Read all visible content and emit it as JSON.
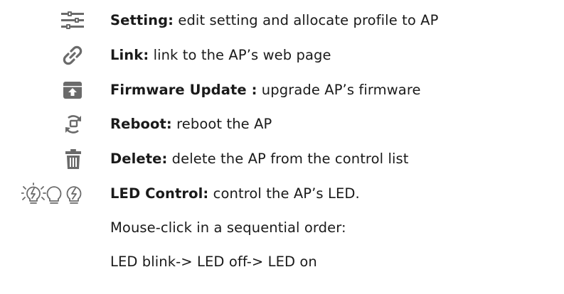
{
  "items": [
    {
      "icon": "settings-sliders-icon",
      "label": "Setting:",
      "desc": " edit setting and allocate profile to AP"
    },
    {
      "icon": "link-icon",
      "label": "Link:",
      "desc": " link to the AP’s web page"
    },
    {
      "icon": "firmware-update-icon",
      "label": "Firmware Update :",
      "desc": " upgrade AP’s firmware"
    },
    {
      "icon": "reboot-icon",
      "label": "Reboot:",
      "desc": " reboot the AP"
    },
    {
      "icon": "trash-icon",
      "label": "Delete:",
      "desc": " delete the AP from the control list"
    },
    {
      "icon": "led-bulbs-icon",
      "label": "LED Control:",
      "desc": " control the AP’s LED."
    }
  ],
  "notes": [
    "Mouse-click in a sequential order:",
    "LED blink-> LED off-> LED on"
  ],
  "colors": {
    "icon": "#5f5f5f",
    "text": "#1a1a1a"
  }
}
